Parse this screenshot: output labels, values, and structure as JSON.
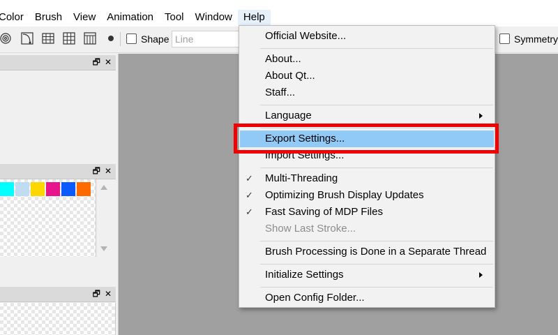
{
  "menubar": {
    "items": [
      "Color",
      "Brush",
      "View",
      "Animation",
      "Tool",
      "Window",
      "Help"
    ]
  },
  "toolbar": {
    "shape_label": "Shape",
    "shape_value": "Line",
    "symmetry_label": "Symmetry"
  },
  "swatches": [
    "#00ffff",
    "#c0dcf0",
    "#ffd700",
    "#e8148c",
    "#0a5aff",
    "#ff6a00"
  ],
  "help_menu": {
    "items": [
      {
        "label": "Official Website..."
      },
      {
        "label": "About..."
      },
      {
        "label": "About Qt..."
      },
      {
        "label": "Staff..."
      },
      {
        "label": "Language"
      },
      {
        "label": "Export Settings..."
      },
      {
        "label": "Import Settings..."
      },
      {
        "label": "Multi-Threading"
      },
      {
        "label": "Optimizing Brush Display Updates"
      },
      {
        "label": "Fast Saving of MDP Files"
      },
      {
        "label": "Show Last Stroke..."
      },
      {
        "label": "Brush Processing is Done in a Separate Thread"
      },
      {
        "label": "Initialize Settings"
      },
      {
        "label": "Open Config Folder..."
      }
    ],
    "check_glyph": "✓"
  },
  "panel_icons": {
    "float": "🗗",
    "close": "✕"
  },
  "colors": {
    "highlight": "#91c9f7",
    "annotation": "#f00000",
    "canvas_bg": "#a0a0a0"
  }
}
